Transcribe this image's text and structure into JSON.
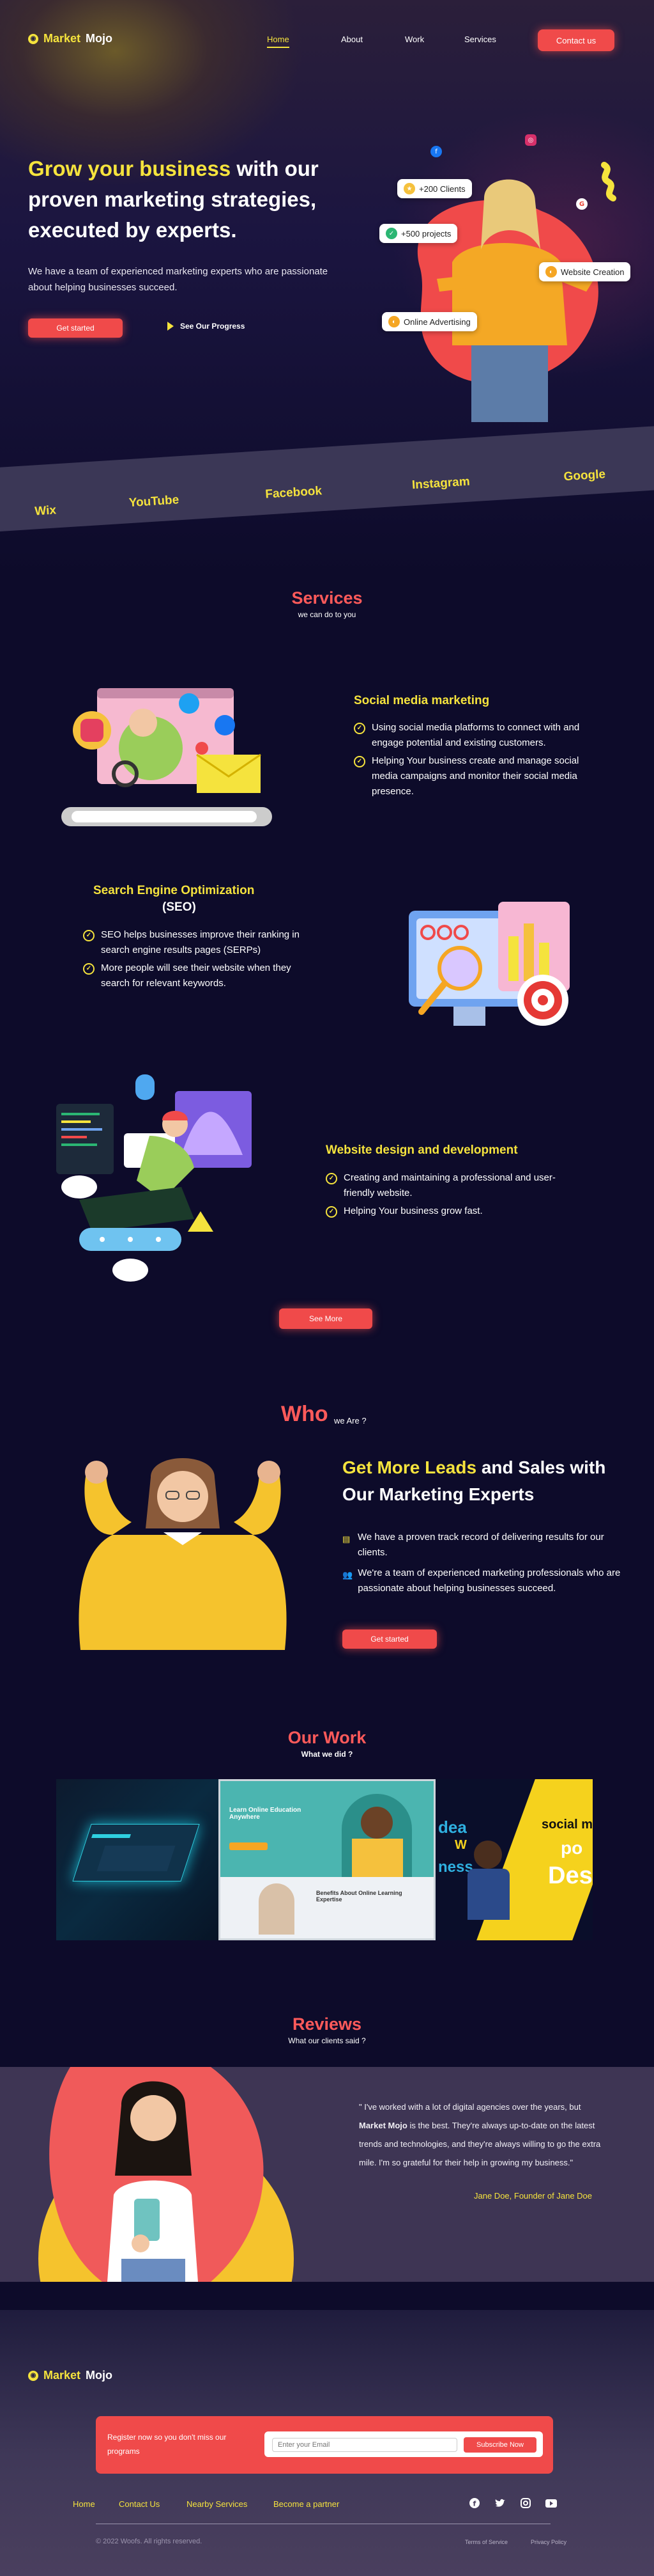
{
  "brand": {
    "name_part1": "Market",
    "name_part2": "Mojo"
  },
  "nav": {
    "items": [
      "Home",
      "About",
      "Work",
      "Services"
    ],
    "contact_label": "Contact us"
  },
  "hero": {
    "title_highlight": "Grow your business",
    "title_rest": " with our proven marketing strategies, executed by experts.",
    "subtitle": "We have a team of experienced marketing experts who are passionate about helping businesses succeed.",
    "cta_label": "Get started",
    "progress_label": "See Our Progress",
    "badges": [
      "+200 Clients",
      "+500 projects",
      "Website Creation",
      "Online Advertising"
    ]
  },
  "ribbon": [
    "Wix",
    "YouTube",
    "Facebook",
    "Instagram",
    "Google"
  ],
  "services": {
    "title": "Services",
    "subtitle": "we can do to you",
    "items": [
      {
        "title": "Social media marketing",
        "points": [
          "Using social media platforms to connect with and engage potential and existing customers.",
          "Helping Your business create and manage social media campaigns and monitor their social media presence."
        ]
      },
      {
        "title": "Search Engine Optimization",
        "title2": "(SEO)",
        "points": [
          "SEO helps businesses improve their ranking in search engine results pages (SERPs)",
          "More people will see their website when they search for relevant keywords."
        ]
      },
      {
        "title": "Website design and development",
        "points": [
          "Creating and maintaining a professional and user-friendly website.",
          "Helping Your business grow fast."
        ]
      }
    ],
    "see_more_label": "See More"
  },
  "who": {
    "title": "Who",
    "subtitle": "we Are ?",
    "heading_highlight": "Get More Leads",
    "heading_rest": " and Sales with Our Marketing Experts",
    "points": [
      "We have a proven track record of delivering results for our clients.",
      "We're a team of experienced marketing professionals who are passionate about helping businesses succeed."
    ],
    "cta_label": "Get started"
  },
  "work": {
    "title": "Our Work",
    "subtitle": "What we did ?",
    "shot_texts": {
      "lp_head": "Learn Online Education Anywhere",
      "lp_sub": "Benefits About Online Learning Expertise",
      "ad_line1": "dea",
      "ad_line2": "W",
      "ad_line3": "ness",
      "ad_social": "social m",
      "ad_po": "po",
      "ad_des": "Des"
    }
  },
  "reviews": {
    "title": "Reviews",
    "subtitle": "What our clients said ?",
    "quote_open": "\" I've worked with a lot of digital agencies over the years, but ",
    "quote_brand": "Market Mojo",
    "quote_rest": " is the best. They're always up-to-date on the latest trends and technologies, and they're always willing to go the extra mile. I'm so grateful for their help in growing my business.\"",
    "author": "Jane Doe, Founder of Jane Doe"
  },
  "footer": {
    "register_text": "Register now so you don't miss our programs",
    "email_placeholder": "Enter your Email",
    "subscribe_label": "Subscribe Now",
    "links": [
      "Home",
      "Contact Us",
      "Nearby Services",
      "Become a partner"
    ],
    "copyright": "© 2022 Woofs. All rights reserved.",
    "terms": [
      "Terms of Service",
      "Privacy Policy"
    ]
  },
  "colors": {
    "accent_yellow": "#f5e33d",
    "accent_red": "#f04a4a",
    "bg_dark": "#0d0b2a"
  }
}
